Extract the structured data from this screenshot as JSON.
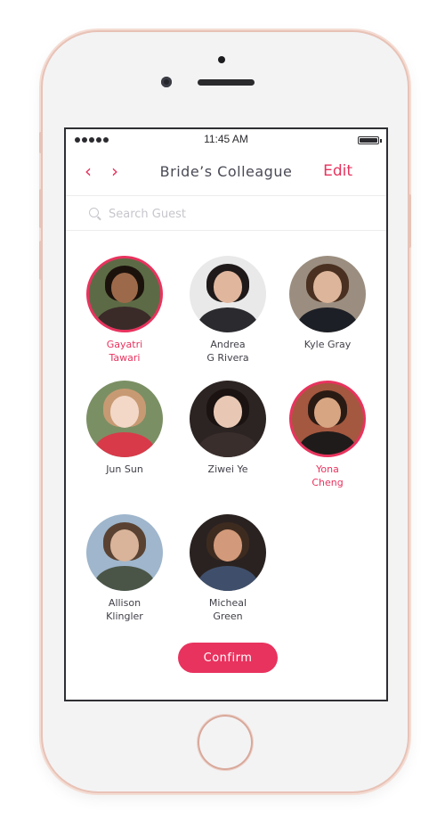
{
  "status": {
    "time": "11:45 AM"
  },
  "header": {
    "title": "Bride’s Colleague",
    "back_icon": "chevron-left-icon",
    "forward_icon": "chevron-right-icon",
    "edit_label": "Edit"
  },
  "search": {
    "placeholder": "Search Guest",
    "value": ""
  },
  "guests": [
    {
      "line1": "Gayatri",
      "line2": "Tawari",
      "selected": true
    },
    {
      "line1": "Andrea",
      "line2": "G Rivera",
      "selected": false
    },
    {
      "line1": "Kyle Gray",
      "line2": "",
      "selected": false
    },
    {
      "line1": "Jun Sun",
      "line2": "",
      "selected": false
    },
    {
      "line1": "Ziwei Ye",
      "line2": "",
      "selected": false
    },
    {
      "line1": "Yona",
      "line2": "Cheng",
      "selected": true
    },
    {
      "line1": "Allison",
      "line2": "Klingler",
      "selected": false
    },
    {
      "line1": "Micheal",
      "line2": "Green",
      "selected": false
    }
  ],
  "confirm_label": "Confirm",
  "colors": {
    "accent": "#e8335e",
    "text": "#3f3f48"
  }
}
